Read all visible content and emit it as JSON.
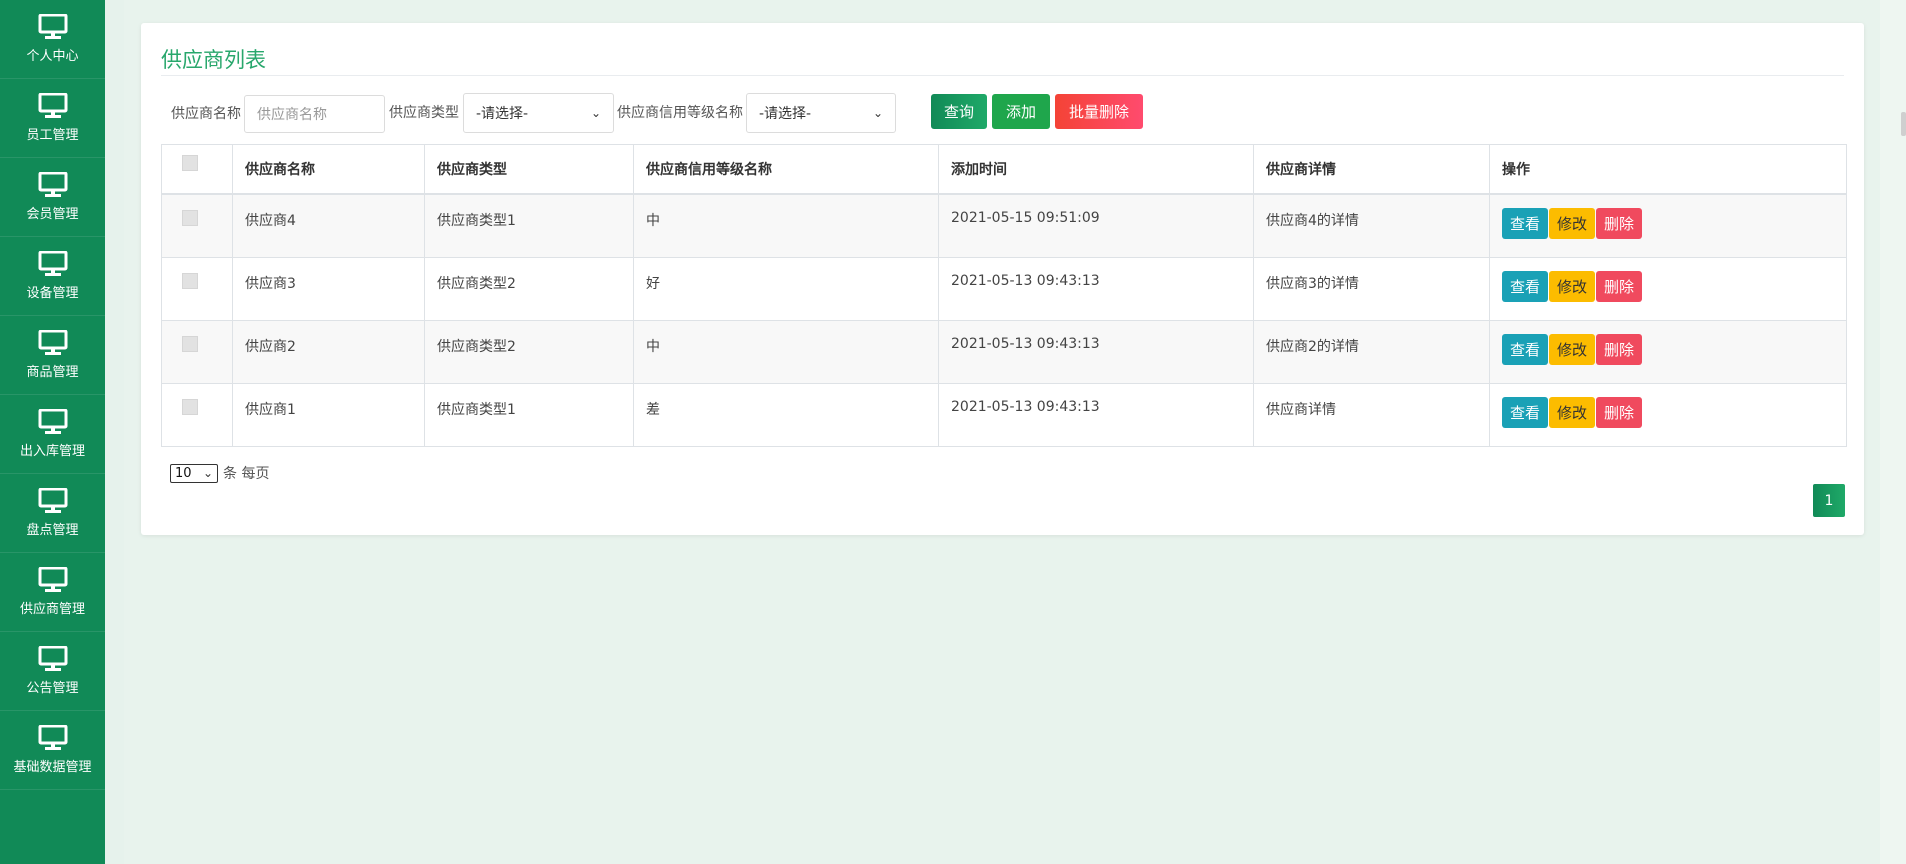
{
  "sidebar": {
    "items": [
      {
        "label": "个人中心",
        "icon": "monitor-icon"
      },
      {
        "label": "员工管理",
        "icon": "monitor-icon"
      },
      {
        "label": "会员管理",
        "icon": "monitor-icon"
      },
      {
        "label": "设备管理",
        "icon": "monitor-icon"
      },
      {
        "label": "商品管理",
        "icon": "monitor-icon"
      },
      {
        "label": "出入库管理",
        "icon": "monitor-icon"
      },
      {
        "label": "盘点管理",
        "icon": "monitor-icon"
      },
      {
        "label": "供应商管理",
        "icon": "monitor-icon"
      },
      {
        "label": "公告管理",
        "icon": "monitor-icon"
      },
      {
        "label": "基础数据管理",
        "icon": "monitor-icon"
      }
    ]
  },
  "page": {
    "title": "供应商列表"
  },
  "filters": {
    "name_label": "供应商名称",
    "name_placeholder": "供应商名称",
    "type_label": "供应商类型",
    "type_selected": "-请选择-",
    "grade_label": "供应商信用等级名称",
    "grade_selected": "-请选择-"
  },
  "actions": {
    "query": "查询",
    "add": "添加",
    "batch_delete": "批量删除"
  },
  "table": {
    "headers": [
      "供应商名称",
      "供应商类型",
      "供应商信用等级名称",
      "添加时间",
      "供应商详情",
      "操作"
    ],
    "rows": [
      {
        "name": "供应商4",
        "type": "供应商类型1",
        "grade": "中",
        "time": "2021-05-15 09:51:09",
        "detail": "供应商4的详情"
      },
      {
        "name": "供应商3",
        "type": "供应商类型2",
        "grade": "好",
        "time": "2021-05-13 09:43:13",
        "detail": "供应商3的详情"
      },
      {
        "name": "供应商2",
        "type": "供应商类型2",
        "grade": "中",
        "time": "2021-05-13 09:43:13",
        "detail": "供应商2的详情"
      },
      {
        "name": "供应商1",
        "type": "供应商类型1",
        "grade": "差",
        "time": "2021-05-13 09:43:13",
        "detail": "供应商详情"
      }
    ],
    "row_actions": {
      "view": "查看",
      "edit": "修改",
      "delete": "删除"
    }
  },
  "pagination": {
    "page_size": "10",
    "per_page_text": "条 每页",
    "current_page": "1"
  },
  "colors": {
    "primary": "#118a57",
    "view": "#1aa1b6",
    "edit": "#fcbc00",
    "delete": "#f04a5e"
  }
}
